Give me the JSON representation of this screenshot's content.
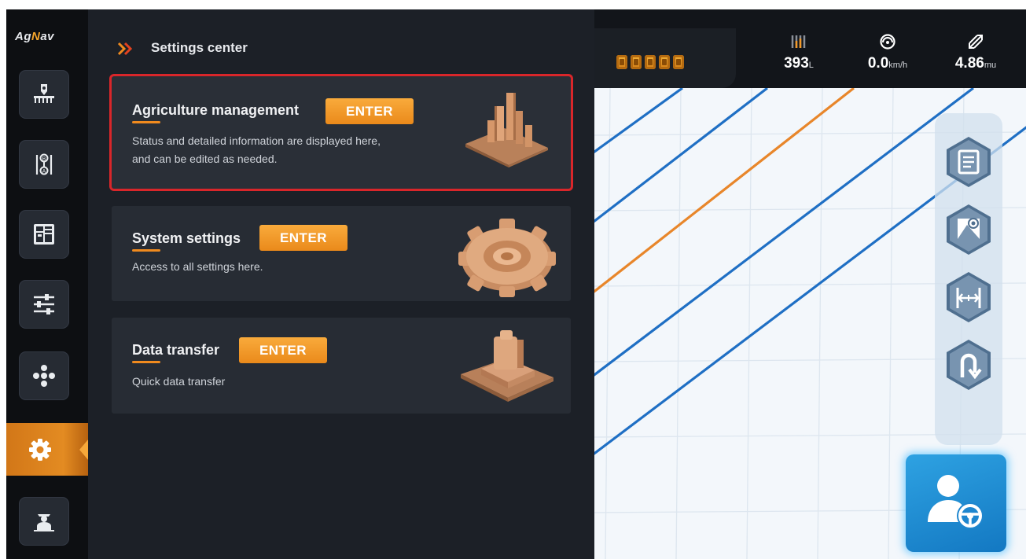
{
  "app": {
    "logo_text_a": "Ag",
    "logo_text_n": "N",
    "logo_text_b": "av"
  },
  "sidebar": {
    "items": [
      {
        "name": "implement"
      },
      {
        "name": "guidance-lines"
      },
      {
        "name": "field-manager"
      },
      {
        "name": "adjustments"
      },
      {
        "name": "satellite"
      },
      {
        "name": "settings",
        "active": true
      },
      {
        "name": "operator"
      }
    ]
  },
  "panel": {
    "title": "Settings center",
    "cards": [
      {
        "title": "Agriculture management",
        "button": "ENTER",
        "desc_line1": "Status and detailed information are displayed here,",
        "desc_line2": "and can be edited as needed.",
        "selected": true
      },
      {
        "title": "System settings",
        "button": "ENTER",
        "desc_line1": "Access to all settings here."
      },
      {
        "title": "Data transfer",
        "button": "ENTER",
        "desc_line1": "Quick data transfer"
      }
    ]
  },
  "status": {
    "tank_value": "393",
    "tank_unit": "L",
    "speed_value": "0.0",
    "speed_unit": "km/h",
    "area_value": "4.86",
    "area_unit": "mu"
  },
  "colors": {
    "accent": "#f08a1e",
    "selected_border": "#d9262a",
    "guidance_line": "#1f6fc4",
    "active_line": "#e8862a",
    "drive_button": "#1f8ad4"
  }
}
